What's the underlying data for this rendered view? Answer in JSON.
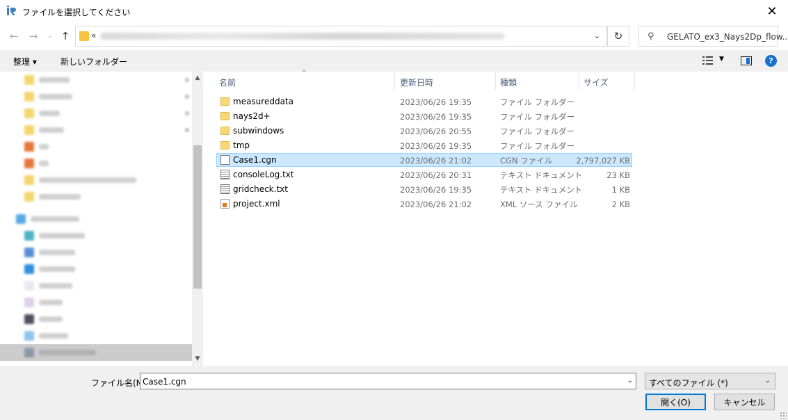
{
  "window": {
    "title": "ファイルを選択してください",
    "close_glyph": "✕",
    "accent": "#0078d7"
  },
  "address": {
    "overflow_glyph": "«",
    "dropdown_glyph": "⌄",
    "refresh_glyph": "↻"
  },
  "search": {
    "text": "GELATO_ex3_Nays2Dp_flow..."
  },
  "toolbar": {
    "organize_label": "整理 ▾",
    "new_folder_label": "新しいフォルダー",
    "help_glyph": "?",
    "view_dropdown_glyph": "▼"
  },
  "columns": {
    "name": "名前",
    "date": "更新日時",
    "type": "種類",
    "size": "サイズ"
  },
  "files": [
    {
      "name": "measureddata",
      "date": "2023/06/26 19:35",
      "type": "ファイル フォルダー",
      "size": "",
      "icon": "folder-icon"
    },
    {
      "name": "nays2d+",
      "date": "2023/06/26 19:35",
      "type": "ファイル フォルダー",
      "size": "",
      "icon": "folder-icon"
    },
    {
      "name": "subwindows",
      "date": "2023/06/26 20:55",
      "type": "ファイル フォルダー",
      "size": "",
      "icon": "folder-icon"
    },
    {
      "name": "tmp",
      "date": "2023/06/26 19:35",
      "type": "ファイル フォルダー",
      "size": "",
      "icon": "folder-icon"
    },
    {
      "name": "Case1.cgn",
      "date": "2023/06/26 21:02",
      "type": "CGN ファイル",
      "size": "2,797,027 KB",
      "icon": "file-icon",
      "selected": true
    },
    {
      "name": "consoleLog.txt",
      "date": "2023/06/26 20:31",
      "type": "テキスト ドキュメント",
      "size": "23 KB",
      "icon": "text-file-icon"
    },
    {
      "name": "gridcheck.txt",
      "date": "2023/06/26 19:35",
      "type": "テキスト ドキュメント",
      "size": "1 KB",
      "icon": "text-file-icon"
    },
    {
      "name": "project.xml",
      "date": "2023/06/26 21:02",
      "type": "XML ソース ファイル",
      "size": "2 KB",
      "icon": "xml-file-icon"
    }
  ],
  "footer": {
    "filename_label": "ファイル名(N):",
    "filename_value": "Case1.cgn",
    "filter_value": "すべてのファイル (*)",
    "open_label": "開く(O)",
    "cancel_label": "キャンセル"
  }
}
